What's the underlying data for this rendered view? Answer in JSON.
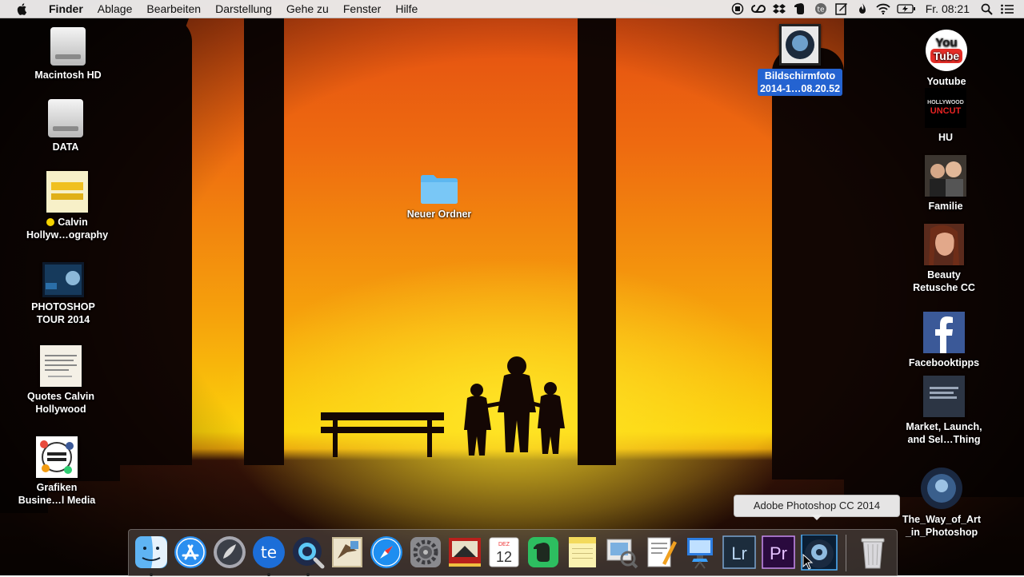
{
  "menubar": {
    "app_name": "Finder",
    "items": [
      "Ablage",
      "Bearbeiten",
      "Darstellung",
      "Gehe zu",
      "Fenster",
      "Hilfe"
    ],
    "clock": "Fr. 08:21",
    "status_icons": [
      "record-icon",
      "creative-cloud-icon",
      "dropbox-icon",
      "evernote-icon",
      "te-icon",
      "notes-icon",
      "flame-icon",
      "wifi-icon",
      "battery-charging-icon",
      "spotlight-icon",
      "notification-center-icon"
    ]
  },
  "desktop_left": [
    {
      "label": "Macintosh HD",
      "icon": "hard-drive-icon"
    },
    {
      "label": "DATA",
      "icon": "hard-drive-icon"
    },
    {
      "label": "Calvin\nHollyw…ography",
      "icon": "calvin-hollywood-thumbnail",
      "tag_color": "#f5d300"
    },
    {
      "label": "PHOTOSHOP\nTOUR 2014",
      "icon": "photoshop-tour-thumbnail"
    },
    {
      "label": "Quotes Calvin\nHollywood",
      "icon": "quotes-document-thumbnail"
    },
    {
      "label": "Grafiken\nBusine…l Media",
      "icon": "social-media-thumbnail"
    }
  ],
  "desktop_center": {
    "label": "Neuer Ordner",
    "icon": "folder-icon"
  },
  "desktop_right_top": {
    "label": "Bildschirmfoto\n2014-1…08.20.52",
    "icon": "screenshot-thumbnail"
  },
  "desktop_right": [
    {
      "label": "Youtube",
      "icon": "youtube-icon",
      "icon_text_top": "You",
      "icon_text_bottom": "Tube"
    },
    {
      "label": "HU",
      "icon": "hollywood-uncut-icon",
      "icon_text_top": "HOLLYWOOD",
      "icon_text_bottom": "UNCUT"
    },
    {
      "label": "Familie",
      "icon": "family-photo-thumbnail"
    },
    {
      "label": "Beauty\nRetusche CC",
      "icon": "beauty-portrait-thumbnail"
    },
    {
      "label": "Facebooktipps",
      "icon": "facebook-icon"
    },
    {
      "label": "Market, Launch,\nand Sel…Thing",
      "icon": "book-cover-thumbnail"
    },
    {
      "label": "The_Way_of_Art\n_in_Photoshop",
      "icon": "photoshop-art-thumbnail"
    }
  ],
  "dock": {
    "items": [
      {
        "name": "finder",
        "running": true
      },
      {
        "name": "app-store",
        "running": false
      },
      {
        "name": "launchpad",
        "running": false
      },
      {
        "name": "teamviewer",
        "running": true
      },
      {
        "name": "quicktime",
        "running": true
      },
      {
        "name": "mail",
        "running": false
      },
      {
        "name": "safari",
        "running": false
      },
      {
        "name": "system-preferences",
        "running": false
      },
      {
        "name": "photo-booth",
        "running": false
      },
      {
        "name": "calendar",
        "running": false,
        "month": "DEZ",
        "day": "12"
      },
      {
        "name": "evernote",
        "running": false
      },
      {
        "name": "notes",
        "running": false
      },
      {
        "name": "preview",
        "running": false
      },
      {
        "name": "pages",
        "running": false
      },
      {
        "name": "keynote",
        "running": false
      },
      {
        "name": "lightroom",
        "running": false,
        "text": "Lr"
      },
      {
        "name": "premiere",
        "running": false,
        "text": "Pr"
      },
      {
        "name": "photoshop",
        "running": false
      }
    ],
    "tooltip": "Adobe Photoshop CC 2014"
  }
}
